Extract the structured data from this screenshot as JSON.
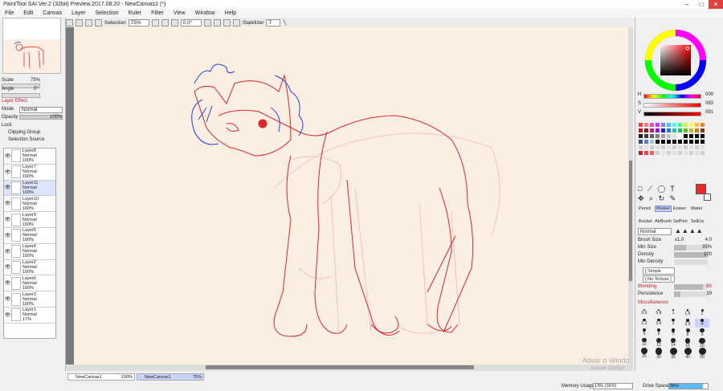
{
  "title": "PaintTool SAI Ver.2 (32bit) Preview.2017.08.20 - NewCanvas1 (*)",
  "menu": [
    "File",
    "Edit",
    "Canvas",
    "Layer",
    "Selection",
    "Ruler",
    "Filter",
    "View",
    "Window",
    "Help"
  ],
  "toolbar": {
    "selection_label": "Selection",
    "zoom": "75%",
    "angle": "0.0°",
    "stabilizer_label": "Stabilizer",
    "stabilizer": "7"
  },
  "navigator": {
    "scale_label": "Scale",
    "scale": "75%",
    "angle_label": "Angle",
    "angle": "0°"
  },
  "layer_effect": {
    "title": "Layer Effect",
    "mode_label": "Mode",
    "mode": "Normal",
    "opacity_label": "Opacity",
    "opacity": "100%",
    "lock_label": "Lock",
    "clipping": "Clipping Group",
    "selection_source": "Selection Source"
  },
  "layers": [
    {
      "name": "Layer8",
      "mode": "Normal",
      "opacity": "100%"
    },
    {
      "name": "Layer7",
      "mode": "Normal",
      "opacity": "100%"
    },
    {
      "name": "Layer11",
      "mode": "Normal",
      "opacity": "100%",
      "selected": true
    },
    {
      "name": "Layer10",
      "mode": "Normal",
      "opacity": "100%"
    },
    {
      "name": "Layer9",
      "mode": "Normal",
      "opacity": "100%"
    },
    {
      "name": "Layer5",
      "mode": "Normal",
      "opacity": "100%"
    },
    {
      "name": "Layer4",
      "mode": "Normal",
      "opacity": "100%"
    },
    {
      "name": "Layer2",
      "mode": "Normal",
      "opacity": "100%"
    },
    {
      "name": "Layer6",
      "mode": "Normal",
      "opacity": "100%"
    },
    {
      "name": "Layer3",
      "mode": "Normal",
      "opacity": "100%"
    },
    {
      "name": "Layer1",
      "mode": "Normal",
      "opacity": "17%"
    }
  ],
  "color": {
    "h_label": "H",
    "h": "000",
    "s_label": "S",
    "s": "083",
    "v_label": "V",
    "v": "091",
    "current": "#e8282a"
  },
  "tools": [
    "Pencil",
    "Marker",
    "Eraser",
    "Water",
    "Bucket",
    "AirBrush",
    "SelPen",
    "SelErs"
  ],
  "brush": {
    "mode": "Normal",
    "size_label": "Brush Size",
    "size_mult": "x1.0",
    "size": "4.0",
    "min_size_label": "Min Size",
    "min_size": "35%",
    "density_label": "Density",
    "density": "100",
    "min_density_label": "Min Density",
    "shape": "[ Simple Circle ]",
    "texture": "[ No Texture ]",
    "blending_label": "Blending",
    "blending": "85",
    "persistence_label": "Persistence",
    "persistence": "19",
    "misc_label": "Miscellaneous"
  },
  "brush_sizes": [
    "0.6",
    "0.8",
    "1",
    "1.5",
    "2",
    "2.3",
    "2.6",
    "3",
    "3.5",
    "4",
    "5",
    "6",
    "7",
    "8",
    "9",
    "10",
    "12",
    "14",
    "16",
    "20",
    "25",
    "30",
    "35",
    "40",
    "50"
  ],
  "documents": [
    {
      "name": "NewCanvas1",
      "zoom": "100%"
    },
    {
      "name": "NewCanvas1",
      "zoom": "75%"
    }
  ],
  "status": {
    "memory_label": "Memory Usage",
    "memory": "13% (16%)",
    "drive_label": "Drive Space",
    "drive": "88%"
  },
  "watermark": {
    "line1": "Ativar o Windo",
    "line2": "Acesse Configu"
  }
}
